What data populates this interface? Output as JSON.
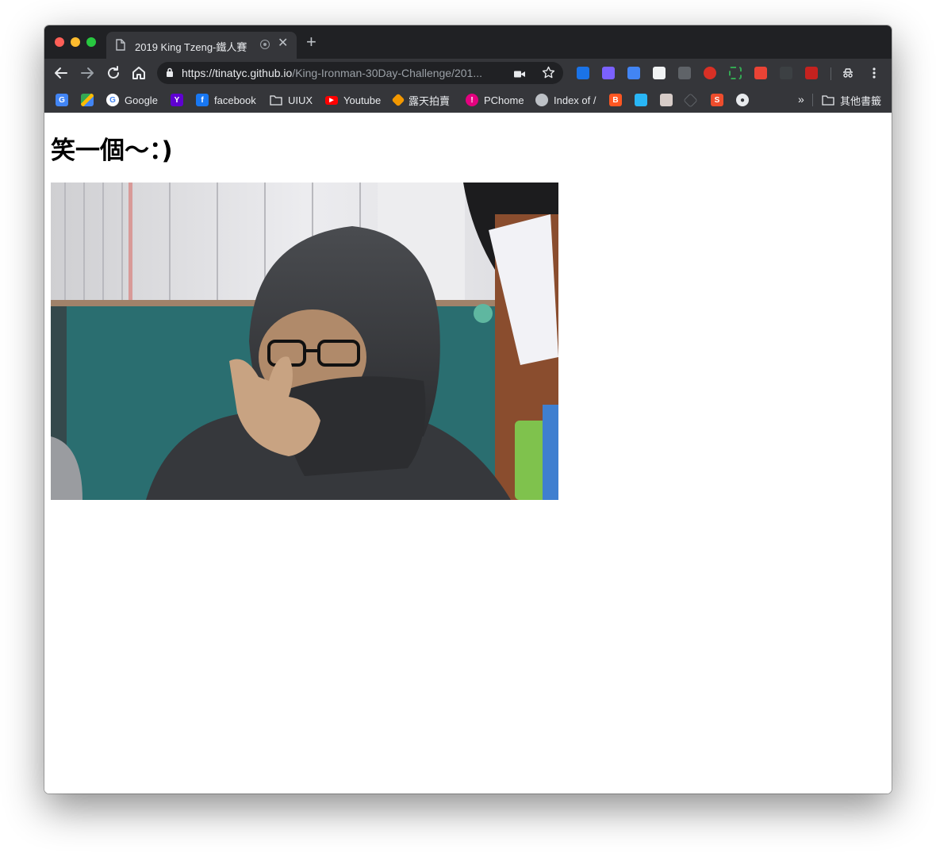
{
  "browser": {
    "tab": {
      "title": "2019 King Tzeng-鐵人賽"
    },
    "url": {
      "host": "https://tinatyc.github.io",
      "path": "/King-Ironman-30Day-Challenge/201..."
    }
  },
  "bookmarks": [
    {
      "label": "",
      "icon": "google-translate-icon",
      "color": "#4285f4"
    },
    {
      "label": "",
      "icon": "google-maps-icon",
      "color": "#34a853"
    },
    {
      "label": "Google",
      "icon": "google-icon",
      "color": "#ffffff"
    },
    {
      "label": "",
      "icon": "yahoo-icon",
      "color": "#5f01d1"
    },
    {
      "label": "facebook",
      "icon": "facebook-icon",
      "color": "#1877f2"
    },
    {
      "label": "UIUX",
      "icon": "folder-icon",
      "color": "#e8eaed"
    },
    {
      "label": "Youtube",
      "icon": "youtube-icon",
      "color": "#ff0000"
    },
    {
      "label": "露天拍賣",
      "icon": "ruten-icon",
      "color": "#f39800"
    },
    {
      "label": "PChome",
      "icon": "pchome-icon",
      "color": "#e4007f"
    },
    {
      "label": "Index of /",
      "icon": "server-icon",
      "color": "#bdc1c6"
    },
    {
      "label": "",
      "icon": "blogger-icon",
      "color": "#ff5722"
    },
    {
      "label": "",
      "icon": "map-tile-icon",
      "color": "#29b6f6"
    },
    {
      "label": "",
      "icon": "photo-icon",
      "color": "#d7ccc8"
    },
    {
      "label": "",
      "icon": "codepen-icon",
      "color": "#5f6368"
    },
    {
      "label": "",
      "icon": "shopee-icon",
      "color": "#ee4d2d"
    },
    {
      "label": "",
      "icon": "github-icon",
      "color": "#e8eaed"
    }
  ],
  "other_bookmarks": {
    "label": "其他書籤"
  },
  "page": {
    "heading": "笑一個～：)"
  }
}
